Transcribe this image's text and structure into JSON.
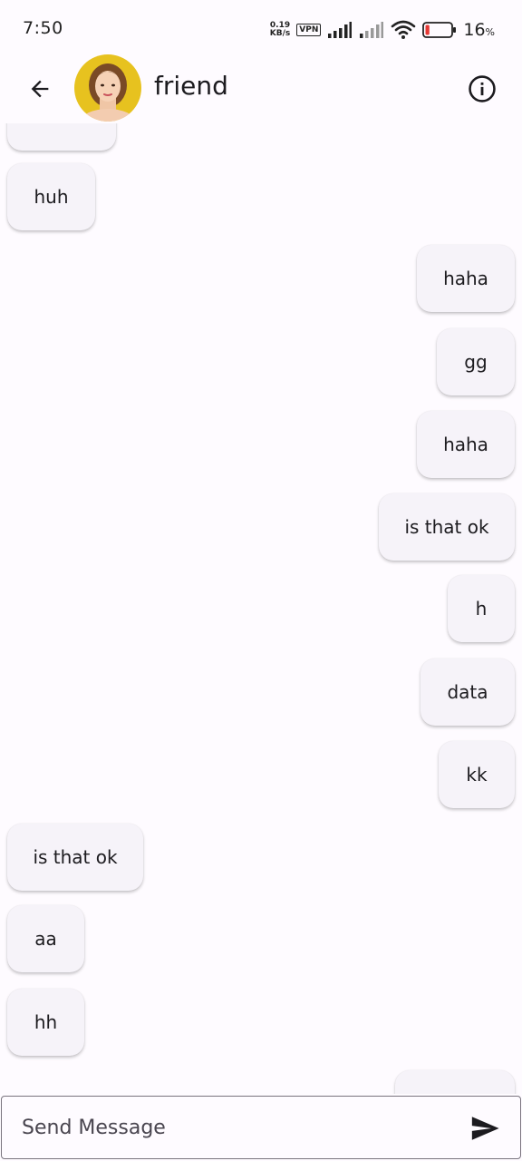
{
  "status_bar": {
    "time": "7:50",
    "net_speed_value": "0.19",
    "net_speed_unit": "KB/s",
    "vpn": "VPN",
    "battery_level": "16",
    "battery_unit": "%",
    "battery_fraction": 0.16,
    "battery_color": "#e53935"
  },
  "header": {
    "contact_name": "friend",
    "avatar_bg": "#e7c21f"
  },
  "messages": [
    {
      "side": "in",
      "text": ""
    },
    {
      "side": "in",
      "text": "huh"
    },
    {
      "side": "out",
      "text": "haha"
    },
    {
      "side": "out",
      "text": "gg"
    },
    {
      "side": "out",
      "text": "haha"
    },
    {
      "side": "out",
      "text": "is that ok"
    },
    {
      "side": "out",
      "text": "h"
    },
    {
      "side": "out",
      "text": "data"
    },
    {
      "side": "out",
      "text": "kk"
    },
    {
      "side": "in",
      "text": "is that ok"
    },
    {
      "side": "in",
      "text": "aa"
    },
    {
      "side": "in",
      "text": "hh"
    },
    {
      "side": "out",
      "text": ""
    }
  ],
  "composer": {
    "placeholder": "Send Message"
  },
  "colors": {
    "background": "#fefbff",
    "bubble": "#f6f3f9",
    "text": "#1c1b1f",
    "field_border": "#79747e"
  },
  "icons": {
    "back": "arrow-back-icon",
    "info": "info-icon",
    "send": "send-icon"
  }
}
